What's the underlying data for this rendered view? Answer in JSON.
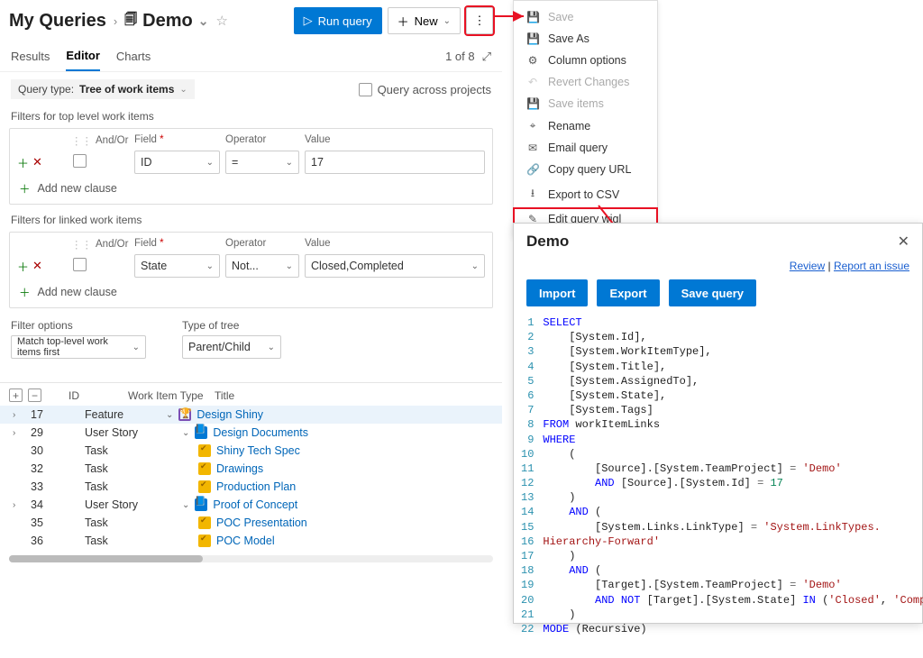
{
  "breadcrumb": {
    "root": "My Queries",
    "page": "Demo"
  },
  "toolbar": {
    "run": "Run query",
    "new": "New",
    "more": "⋮"
  },
  "tabs": {
    "results": "Results",
    "editor": "Editor",
    "charts": "Charts"
  },
  "pager": {
    "text": "1 of 8"
  },
  "queryType": {
    "label": "Query type:",
    "value": "Tree of work items",
    "across": "Query across projects"
  },
  "filterTop": {
    "title": "Filters for top level work items",
    "hdr_andor": "And/Or",
    "hdr_field": "Field",
    "hdr_op": "Operator",
    "hdr_val": "Value",
    "field": "ID",
    "op": "=",
    "val": "17",
    "add": "Add new clause"
  },
  "filterLinked": {
    "title": "Filters for linked work items",
    "field": "State",
    "op": "Not...",
    "val": "Closed,Completed",
    "add": "Add new clause"
  },
  "options": {
    "filterOptions": "Filter options",
    "typeOfTree": "Type of tree",
    "matchFirst": "Match top-level work items first",
    "parentChild": "Parent/Child"
  },
  "resultsHeader": {
    "id": "ID",
    "wit": "Work Item Type",
    "title": "Title"
  },
  "rows": [
    {
      "id": "17",
      "wit": "Feature",
      "icon": "feat",
      "indent": 0,
      "caret": true,
      "title": "Design Shiny",
      "selected": true
    },
    {
      "id": "29",
      "wit": "User Story",
      "icon": "story",
      "indent": 1,
      "caret": true,
      "title": "Design Documents"
    },
    {
      "id": "30",
      "wit": "Task",
      "icon": "task",
      "indent": 2,
      "caret": false,
      "title": "Shiny Tech Spec"
    },
    {
      "id": "32",
      "wit": "Task",
      "icon": "task",
      "indent": 2,
      "caret": false,
      "title": "Drawings"
    },
    {
      "id": "33",
      "wit": "Task",
      "icon": "task",
      "indent": 2,
      "caret": false,
      "title": "Production Plan"
    },
    {
      "id": "34",
      "wit": "User Story",
      "icon": "story",
      "indent": 1,
      "caret": true,
      "title": "Proof of Concept"
    },
    {
      "id": "35",
      "wit": "Task",
      "icon": "task",
      "indent": 2,
      "caret": false,
      "title": "POC Presentation"
    },
    {
      "id": "36",
      "wit": "Task",
      "icon": "task",
      "indent": 2,
      "caret": false,
      "title": "POC Model"
    }
  ],
  "menu": {
    "save": "Save",
    "saveAs": "Save As",
    "columns": "Column options",
    "revert": "Revert Changes",
    "saveItems": "Save items",
    "rename": "Rename",
    "email": "Email query",
    "copyUrl": "Copy query URL",
    "export": "Export to CSV",
    "editWiql": "Edit query wiql"
  },
  "dialog": {
    "title": "Demo",
    "review": "Review",
    "report": "Report an issue",
    "import": "Import",
    "export": "Export",
    "save": "Save query",
    "sep": " | "
  },
  "code": {
    "l1": "SELECT",
    "l2": "    [System.Id],",
    "l3": "    [System.WorkItemType],",
    "l4": "    [System.Title],",
    "l5": "    [System.AssignedTo],",
    "l6": "    [System.State],",
    "l7": "    [System.Tags]",
    "l8a": "FROM",
    "l8b": " workItemLinks",
    "l9": "WHERE",
    "l10": "    (",
    "l11a": "        [Source].[System.TeamProject] ",
    "l11b": "=",
    "l11c": " 'Demo'",
    "l12a": "        ",
    "l12b": "AND",
    "l12c": " [Source].[System.Id] ",
    "l12d": "=",
    "l12e": " 17",
    "l13": "    )",
    "l14a": "    ",
    "l14b": "AND",
    "l14c": " (",
    "l15a": "        [System.Links.LinkType] ",
    "l15b": "=",
    "l15c": " 'System.LinkTypes.",
    "l15x": "Hierarchy-Forward'",
    "l16": "    )",
    "l17a": "    ",
    "l17b": "AND",
    "l17c": " (",
    "l18a": "        [Target].[System.TeamProject] ",
    "l18b": "=",
    "l18c": " 'Demo'",
    "l19a": "        ",
    "l19b": "AND NOT",
    "l19c": " [Target].[System.State] ",
    "l19d": "IN",
    "l19e": " (",
    "l19f": "'Closed'",
    "l19g": ", ",
    "l19h": "'Completed'",
    "l19i": ")",
    "l20": "    )",
    "l21a": "MODE",
    "l21b": " (Recursive)",
    "l22": ""
  }
}
